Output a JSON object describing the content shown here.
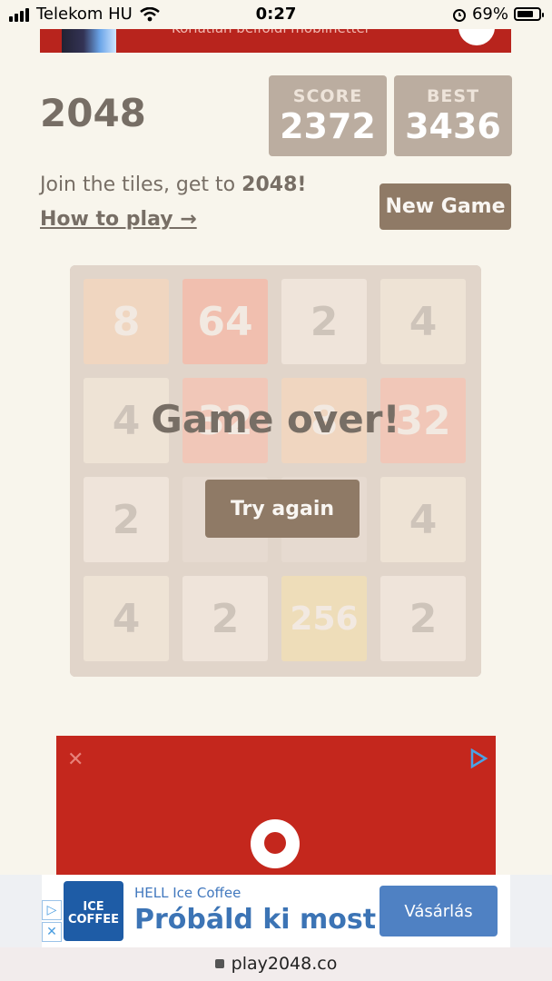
{
  "status_bar": {
    "carrier": "Telekom HU",
    "time": "0:27",
    "battery": "69%"
  },
  "top_ad": {
    "text": "Korlátlan belföldi mobilnettel"
  },
  "header": {
    "title": "2048",
    "score_label": "SCORE",
    "score_value": "2372",
    "best_label": "BEST",
    "best_value": "3436",
    "intro_prefix": "Join the tiles, get to ",
    "intro_goal": "2048!",
    "how_to_play": "How to play →",
    "new_game": "New Game"
  },
  "board": {
    "tiles": [
      [
        "8",
        "64",
        "2",
        "4"
      ],
      [
        "4",
        "32",
        "8",
        "32"
      ],
      [
        "2",
        "",
        "",
        "4"
      ],
      [
        "4",
        "2",
        "256",
        "2"
      ]
    ],
    "colors": {
      "empty": "#cdc1b4",
      "2": "#eee4da",
      "4": "#ede0c8",
      "8": "#f2b179",
      "32": "#f67c5f",
      "64": "#f65e3b",
      "256": "#edcc61",
      "text_dark": "#776e65",
      "text_light": "#f9f6f2"
    },
    "game_over_text": "Game over!",
    "try_again": "Try again"
  },
  "bottom_ad": {
    "brand": "HELL Ice Coffee",
    "headline": "Próbáld ki most",
    "button": "Vásárlás",
    "logo_line1": "ICE",
    "logo_line2": "COFFEE"
  },
  "url_bar": {
    "url": "play2048.co"
  }
}
